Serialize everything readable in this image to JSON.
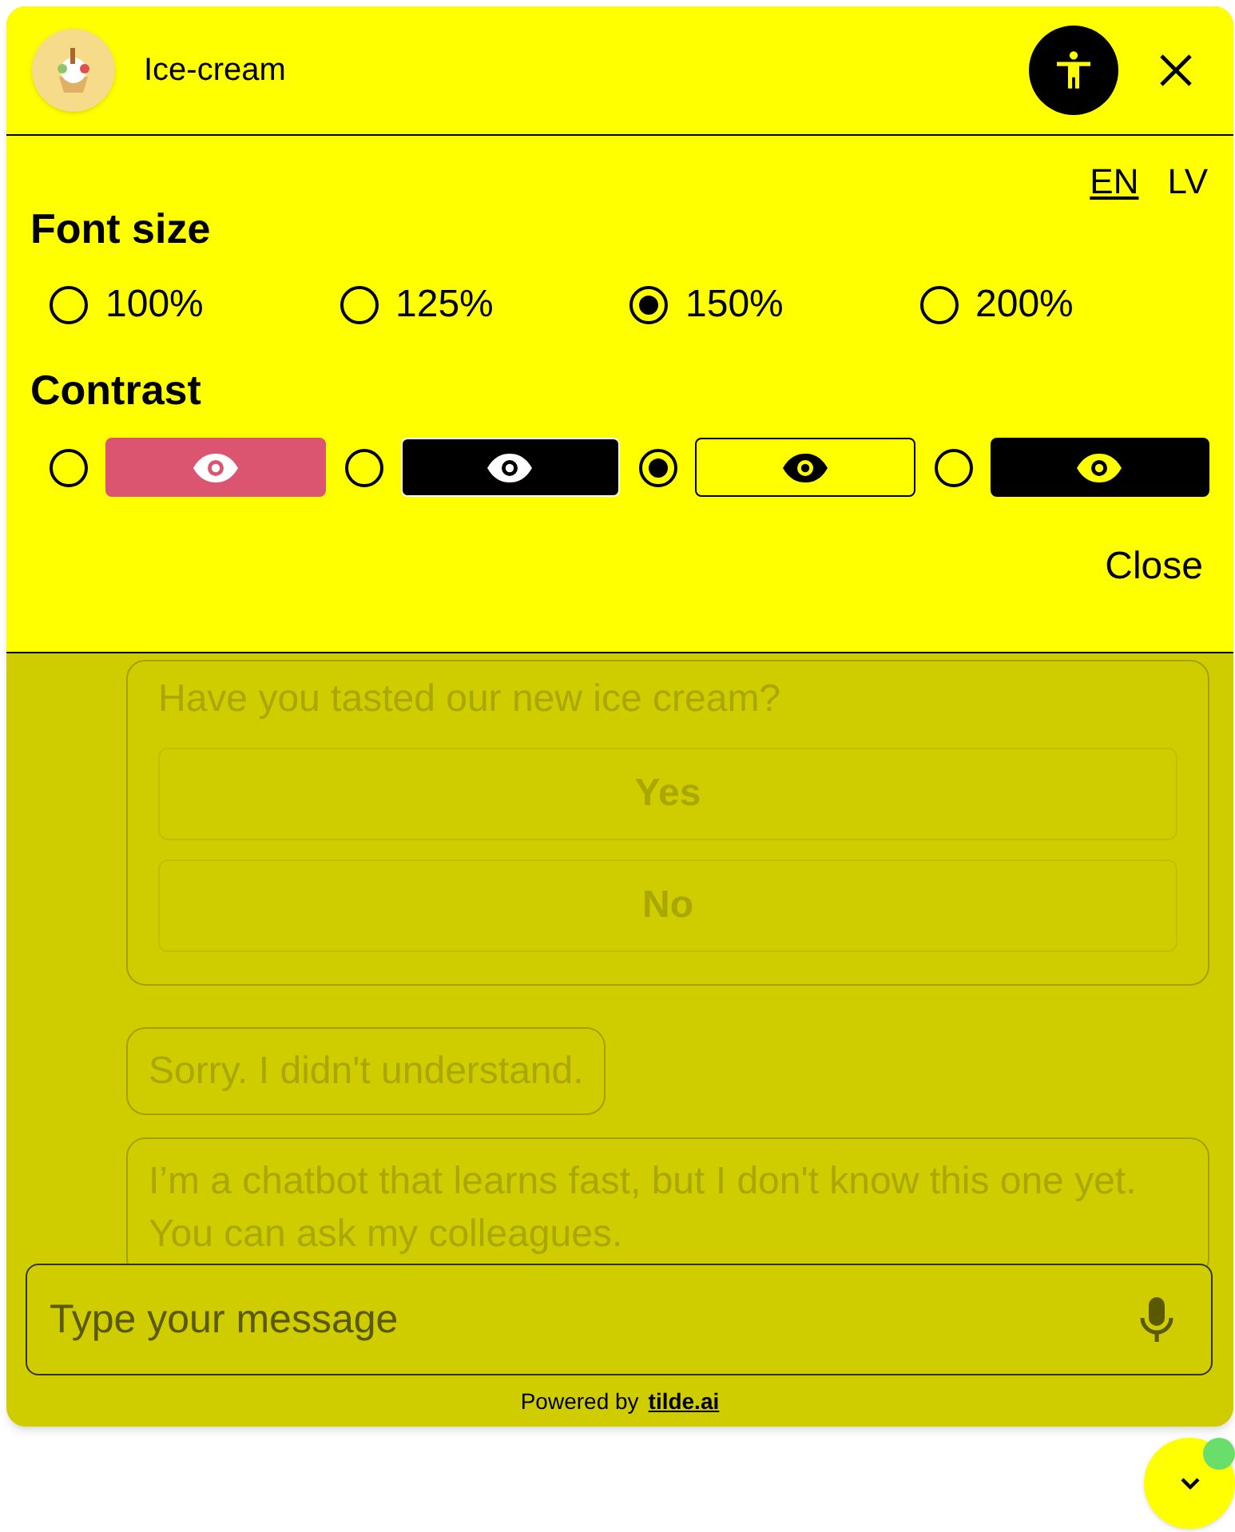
{
  "header": {
    "title": "Ice-cream"
  },
  "accessibility_panel": {
    "languages": [
      {
        "label": "EN",
        "selected": true
      },
      {
        "label": "LV",
        "selected": false
      }
    ],
    "font_size": {
      "heading": "Font size",
      "options": [
        {
          "label": "100%",
          "selected": false
        },
        {
          "label": "125%",
          "selected": false
        },
        {
          "label": "150%",
          "selected": true
        },
        {
          "label": "200%",
          "selected": false
        }
      ]
    },
    "contrast": {
      "heading": "Contrast",
      "options": [
        {
          "kind": "default",
          "selected": false
        },
        {
          "kind": "inverted",
          "selected": false
        },
        {
          "kind": "yellow",
          "selected": true
        },
        {
          "kind": "black",
          "selected": false
        }
      ]
    },
    "close_label": "Close"
  },
  "chat": {
    "question": {
      "text": "Have you tasted our new ice cream?",
      "buttons": [
        "Yes",
        "No"
      ]
    },
    "messages": [
      "Sorry. I didn't understand.",
      "I’m a chatbot that learns fast, but I don't know this one yet. You can ask my colleagues."
    ]
  },
  "composer": {
    "placeholder": "Type your message"
  },
  "footer": {
    "text": "Powered by",
    "link": "tilde.ai"
  },
  "launcher": {
    "has_notification": true
  }
}
